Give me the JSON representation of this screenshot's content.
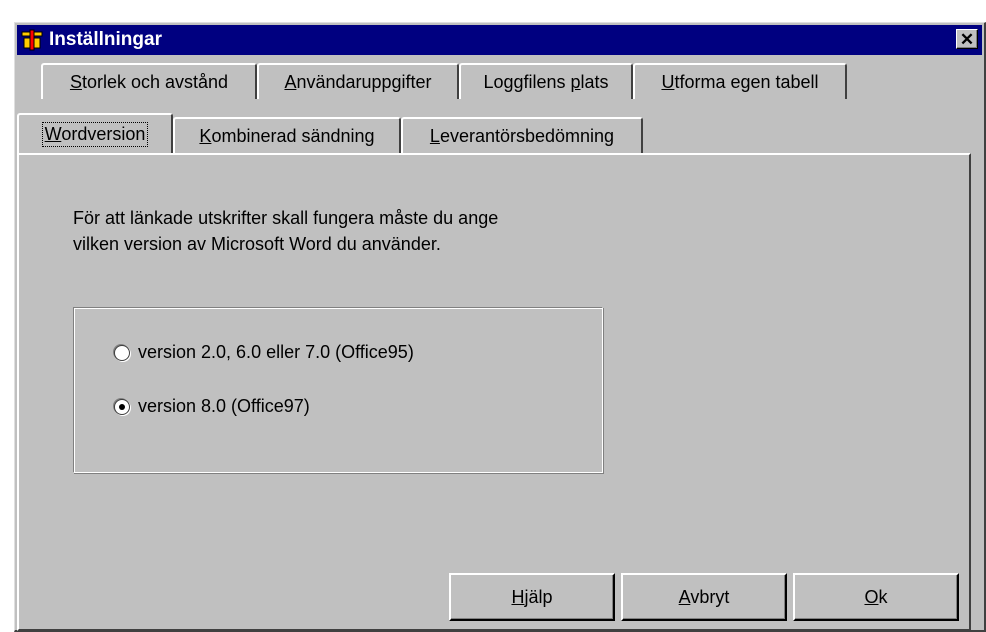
{
  "window": {
    "title": "Inställningar"
  },
  "tabs_back": [
    {
      "prefix": "",
      "hotkey": "S",
      "rest": "torlek och avstånd"
    },
    {
      "prefix": "",
      "hotkey": "A",
      "rest": "nvändaruppgifter"
    },
    {
      "prefix": "Loggfilens ",
      "hotkey": "p",
      "rest": "lats"
    },
    {
      "prefix": "",
      "hotkey": "U",
      "rest": "tforma egen tabell"
    }
  ],
  "tabs_front": [
    {
      "prefix": "",
      "hotkey": "W",
      "rest": "ordversion"
    },
    {
      "prefix": "",
      "hotkey": "K",
      "rest": "ombinerad sändning"
    },
    {
      "prefix": "",
      "hotkey": "L",
      "rest": "everantörsbedömning"
    }
  ],
  "content": {
    "line1": "För att länkade utskrifter skall fungera måste du ange",
    "line2": "vilken version av Microsoft Word du använder.",
    "options": [
      {
        "label": "version 2.0, 6.0 eller 7.0   (Office95)",
        "selected": false
      },
      {
        "label": "version 8.0   (Office97)",
        "selected": true
      }
    ]
  },
  "buttons": {
    "help": {
      "hotkey": "H",
      "rest": "jälp"
    },
    "cancel": {
      "hotkey": "A",
      "rest": "vbryt"
    },
    "ok": {
      "hotkey": "O",
      "rest": "k"
    }
  },
  "colors": {
    "face": "#c0c0c0",
    "titlebar": "#000080"
  }
}
